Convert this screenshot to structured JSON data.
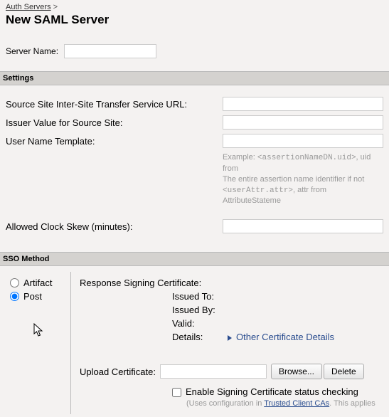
{
  "breadcrumb": {
    "link": "Auth Servers",
    "sep": ">"
  },
  "title": "New SAML Server",
  "server_name_label": "Server Name:",
  "server_name_value": "",
  "section_settings": "Settings",
  "settings": {
    "source_url_label": "Source Site Inter-Site Transfer Service URL:",
    "source_url_value": "",
    "issuer_label": "Issuer Value for Source Site:",
    "issuer_value": "",
    "username_label": "User Name Template:",
    "username_value": "",
    "example_prefix": "Example: ",
    "example_code": "<assertionNameDN.uid>",
    "example_tail": ", uid from",
    "example_line2": "The entire assertion name identifier if not ",
    "example_line3_code": "<userAttr.attr>",
    "example_line3_tail": ", attr from AttributeStateme",
    "clock_label": "Allowed Clock Skew (minutes):",
    "clock_value": ""
  },
  "section_sso": "SSO Method",
  "sso": {
    "artifact_label": "Artifact",
    "post_label": "Post",
    "resp_cert_label": "Response Signing Certificate:",
    "issued_to": "Issued To:",
    "issued_by": "Issued By:",
    "valid": "Valid:",
    "details": "Details:",
    "other_details": "Other Certificate Details",
    "upload_label": "Upload Certificate:",
    "upload_value": "",
    "browse": "Browse...",
    "delete": "Delete",
    "enable_label": "Enable Signing Certificate status checking",
    "enable_note_pre": "(Uses configuration in ",
    "enable_note_link": "Trusted Client CAs",
    "enable_note_post": ". This applies"
  }
}
